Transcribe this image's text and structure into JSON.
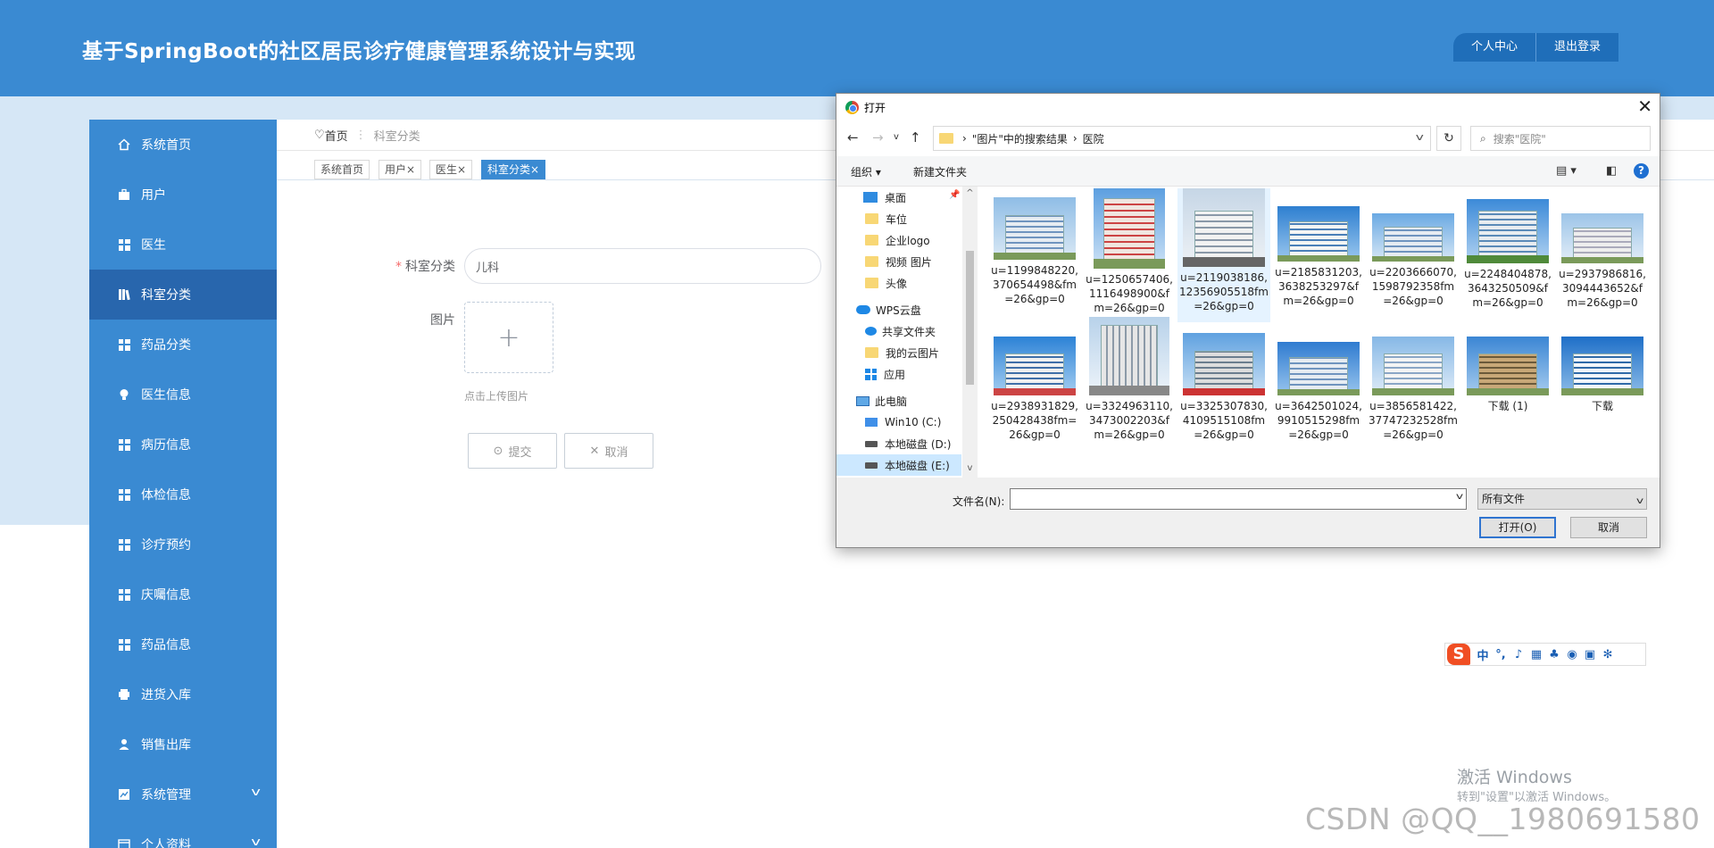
{
  "header": {
    "title": "基于SpringBoot的社区居民诊疗健康管理系统设计与实现",
    "user_center": "个人中心",
    "logout": "退出登录",
    "accent": "#3a8ad2"
  },
  "sidebar": {
    "items": [
      {
        "label": "系统首页",
        "icon": "home-icon"
      },
      {
        "label": "用户",
        "icon": "briefcase-icon"
      },
      {
        "label": "医生",
        "icon": "grid-icon"
      },
      {
        "label": "科室分类",
        "icon": "book-icon",
        "active": true
      },
      {
        "label": "药品分类",
        "icon": "grid-icon"
      },
      {
        "label": "医生信息",
        "icon": "bulb-icon"
      },
      {
        "label": "病历信息",
        "icon": "grid-icon"
      },
      {
        "label": "体检信息",
        "icon": "grid-icon"
      },
      {
        "label": "诊疗预约",
        "icon": "grid-icon"
      },
      {
        "label": "庆囑信息",
        "icon": "grid-icon"
      },
      {
        "label": "药品信息",
        "icon": "grid-icon"
      },
      {
        "label": "进货入库",
        "icon": "printer-icon"
      },
      {
        "label": "销售出库",
        "icon": "user-icon"
      },
      {
        "label": "系统管理",
        "icon": "chart-icon",
        "expandable": true
      },
      {
        "label": "个人资料",
        "icon": "card-icon",
        "expandable": true
      }
    ]
  },
  "breadcrumb": {
    "home": "首页",
    "current": "科室分类"
  },
  "tabs": [
    "系统首页",
    "用户×",
    "医生×",
    "科室分类×"
  ],
  "form": {
    "category_label": "科室分类",
    "category_value": "儿科",
    "image_label": "图片",
    "upload_tip": "点击上传图片",
    "submit": "提交",
    "cancel": "取消"
  },
  "dialog": {
    "title": "打开",
    "path": [
      "\"图片\"中的搜索结果",
      "医院"
    ],
    "search_placeholder": "搜索\"医院\"",
    "organize": "组织 ▾",
    "new_folder": "新建文件夹",
    "tree": [
      {
        "label": "桌面",
        "icon": "desktop-icon",
        "pinned": true
      },
      {
        "label": "车位",
        "icon": "folder-icon"
      },
      {
        "label": "企业logo",
        "icon": "folder-icon"
      },
      {
        "label": "视频 图片",
        "icon": "folder-icon"
      },
      {
        "label": "头像",
        "icon": "folder-icon"
      },
      {
        "label": "WPS云盘",
        "icon": "cloud-icon"
      },
      {
        "label": "共享文件夹",
        "icon": "share-icon"
      },
      {
        "label": "我的云图片",
        "icon": "folder-icon"
      },
      {
        "label": "应用",
        "icon": "apps-icon"
      },
      {
        "label": "此电脑",
        "icon": "pc-icon"
      },
      {
        "label": "Win10 (C:)",
        "icon": "windows-drive-icon"
      },
      {
        "label": "本地磁盘 (D:)",
        "icon": "drive-icon"
      },
      {
        "label": "本地磁盘 (E:)",
        "icon": "drive-icon",
        "selected": true
      }
    ],
    "files": [
      {
        "name": "u=1199848220,370654498&fm=26&gp=0"
      },
      {
        "name": "u=1250657406,1116498900&fm=26&gp=0"
      },
      {
        "name": "u=2119038186,12356905518fm=26&gp=0",
        "selected": true
      },
      {
        "name": "u=2185831203,3638253297&fm=26&gp=0"
      },
      {
        "name": "u=2203666070,1598792358fm=26&gp=0"
      },
      {
        "name": "u=2248404878,3643250509&fm=26&gp=0"
      },
      {
        "name": "u=2937986816,3094443652&fm=26&gp=0"
      },
      {
        "name": "u=2938931829,250428438fm=26&gp=0"
      },
      {
        "name": "u=3324963110,3473002203&fm=26&gp=0"
      },
      {
        "name": "u=3325307830,4109515108fm=26&gp=0"
      },
      {
        "name": "u=3642501024,9910515298fm=26&gp=0"
      },
      {
        "name": "u=3856581422,37747232528fm=26&gp=0"
      },
      {
        "name": "下载 (1)"
      },
      {
        "name": "下载"
      }
    ],
    "filename_label": "文件名(N):",
    "filename_value": "",
    "filter": "所有文件",
    "open_btn": "打开(O)",
    "cancel_btn": "取消"
  },
  "ime": {
    "logo": "S",
    "mode": "中"
  },
  "watermark": {
    "activate_title": "激活 Windows",
    "activate_sub": "转到\"设置\"以激活 Windows。",
    "csdn": "CSDN @QQ__1980691580"
  }
}
